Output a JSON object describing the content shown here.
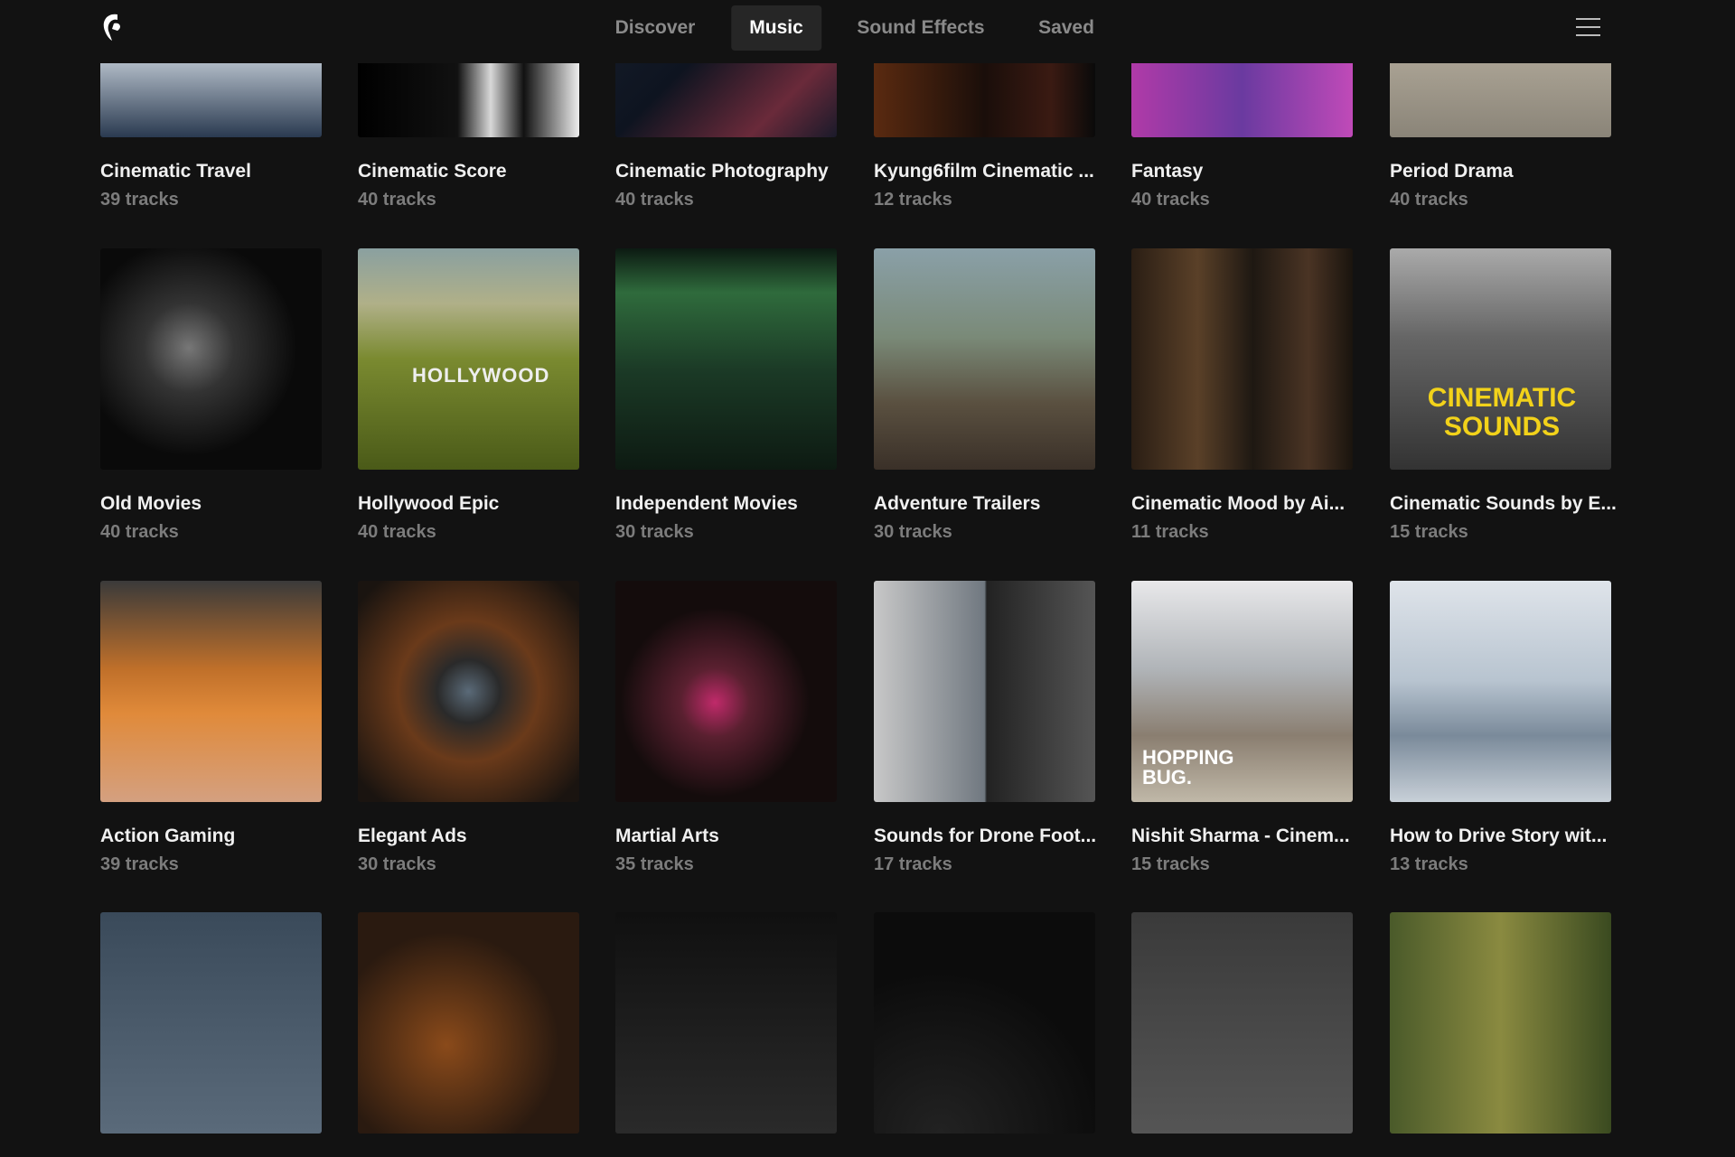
{
  "nav": {
    "tabs": [
      {
        "label": "Discover"
      },
      {
        "label": "Music"
      },
      {
        "label": "Sound Effects"
      },
      {
        "label": "Saved"
      }
    ],
    "active": "Music"
  },
  "cards": [
    {
      "title": "Cinematic Travel",
      "count": "39 tracks",
      "bg": "linear-gradient(180deg,#1c6a6a 0%,#2a4b6e 35%,#c9d2dc 60%,#2a3a50 100%)"
    },
    {
      "title": "Cinematic Score",
      "count": "40 tracks",
      "bg": "linear-gradient(90deg,#000 0%,#111 45%,#d8d8d8 60%,#111 75%,#eee 100%)"
    },
    {
      "title": "Cinematic Photography",
      "count": "40 tracks",
      "bg": "linear-gradient(135deg,#1a2230,#0e1420 50%,#6a2a3a 80%,#1a1a2a)"
    },
    {
      "title": "Kyung6film Cinematic ...",
      "count": "12 tracks",
      "bg": "linear-gradient(90deg,#5a2a10,#1a0e0a 50%,#3a1a12 80%,#0a0a0a)"
    },
    {
      "title": "Fantasy",
      "count": "40 tracks",
      "bg": "linear-gradient(90deg,#b03aa8,#6a3aa0 50%,#c04ab8)"
    },
    {
      "title": "Period Drama",
      "count": "40 tracks",
      "bg": "linear-gradient(180deg,#6a6a68,#b8b0a0 50%,#8a8478)"
    },
    {
      "title": "Old Movies",
      "count": "40 tracks",
      "bg": "radial-gradient(circle at 40% 45%,#777 0%,#333 25%,#0a0a0a 60%)"
    },
    {
      "title": "Hollywood Epic",
      "count": "40 tracks",
      "bg": "linear-gradient(180deg,#8aa0a0 0%,#b0b088 25%,#7a8a30 50%,#4a5a18 100%)"
    },
    {
      "title": "Independent Movies",
      "count": "30 tracks",
      "bg": "linear-gradient(180deg,#0c1a12 0%,#2f6b3c 20%,#1b3a26 55%,#0d1a12 100%)"
    },
    {
      "title": "Adventure Trailers",
      "count": "30 tracks",
      "bg": "linear-gradient(180deg,#8aa0a8 0%,#7a8a78 40%,#5a5040 70%,#3a3028 100%)"
    },
    {
      "title": "Cinematic Mood by Ai...",
      "count": "11 tracks",
      "bg": "linear-gradient(90deg,#2a1e14,#5a4028 30%,#1e1812 55%,#4a3424 80%,#1a140e)"
    },
    {
      "title": "Cinematic Sounds by E...",
      "count": "15 tracks",
      "bg": "linear-gradient(180deg,#aaa 0%,#666 40%,#333 100%)"
    },
    {
      "title": "Action Gaming",
      "count": "39 tracks",
      "bg": "linear-gradient(180deg,#3a3a3a 0%,#c0702a 40%,#e08a3a 60%,#d4a080 100%)"
    },
    {
      "title": "Elegant Ads",
      "count": "30 tracks",
      "bg": "radial-gradient(circle at 50% 50%,#5a6a78 0%,#2a2a2a 20%,#6a3a1a 45%,#1a1410 90%)"
    },
    {
      "title": "Martial Arts",
      "count": "35 tracks",
      "bg": "radial-gradient(circle at 45% 55%,#c02a6a 0%,#5a2030 20%,#140c0c 55%)"
    },
    {
      "title": "Sounds for Drone Foot...",
      "count": "17 tracks",
      "bg": "linear-gradient(90deg,#c8c8c8 0%,#707880 50%,#222 51%,#555 100%)"
    },
    {
      "title": "Nishit Sharma - Cinem...",
      "count": "15 tracks",
      "bg": "linear-gradient(180deg,#e8e8ea 0%,#b0b4b8 40%,#8a7e70 70%,#c0b8a8 100%)"
    },
    {
      "title": "How to Drive Story wit...",
      "count": "13 tracks",
      "bg": "linear-gradient(180deg,#dfe4ea 0%,#b8c4d0 45%,#7a8a9a 70%,#c8d0d8 100%)"
    },
    {
      "title": "",
      "count": "",
      "bg": "linear-gradient(180deg,#3a4a5a,#5a6a7a)"
    },
    {
      "title": "",
      "count": "",
      "bg": "radial-gradient(circle at 40% 60%,#8a4a1a,#2a1a10 60%)"
    },
    {
      "title": "",
      "count": "",
      "bg": "linear-gradient(180deg,#101010,#2a2a2a)"
    },
    {
      "title": "",
      "count": "",
      "bg": "radial-gradient(circle at 30% 100%,#222 0%,#0c0c0c 60%)"
    },
    {
      "title": "",
      "count": "",
      "bg": "linear-gradient(180deg,#3a3a3a,#555)"
    },
    {
      "title": "",
      "count": "",
      "bg": "linear-gradient(90deg,#4a5a2a,#8a8a40 50%,#3a4a20)"
    }
  ],
  "image_text": {
    "hollywood": "HOLLYWOOD",
    "cinematic_sounds": "CINEMATIC SOUNDS",
    "hopping_bug": "HOPPING BUG."
  }
}
